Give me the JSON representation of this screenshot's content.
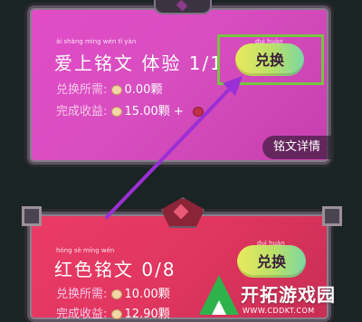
{
  "card1": {
    "title": "爱上铭文 体验 1/1",
    "pinyin_title": "ài shàng míng wén  tǐ yàn",
    "requirement_label": "兑换所需:",
    "requirement_value": "0.00颗",
    "reward_label": "完成收益:",
    "reward_value": "15.00颗 +",
    "button_label": "兑换",
    "button_pinyin": "duì huàn",
    "detail_label": "铭文详情"
  },
  "card2": {
    "title": "红色铭文 0/8",
    "pinyin_title": "hóng sè míng wén",
    "requirement_label": "兑换所需:",
    "requirement_value": "10.00颗",
    "reward_label": "完成收益:",
    "reward_value": "12.90颗",
    "button_label": "兑换",
    "button_pinyin": "duì huàn"
  },
  "watermark": {
    "brand": "开拓游戏园",
    "url": "WWW.CDDKT.COM"
  },
  "colors": {
    "card1_bg": "#d84ec0",
    "card2_bg": "#e0365f",
    "highlight": "#78c342",
    "arrow": "#9b2fd6"
  }
}
